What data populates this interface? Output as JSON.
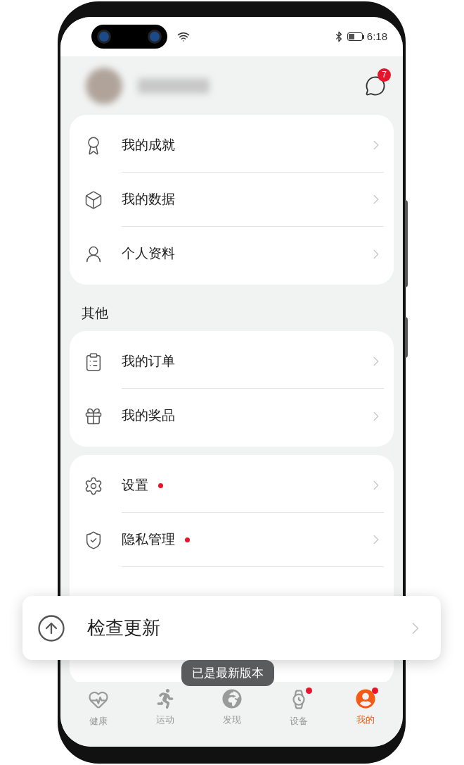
{
  "status_bar": {
    "time": "6:18"
  },
  "header": {
    "messages_badge": "7"
  },
  "sections": [
    {
      "items": [
        {
          "label": "我的成就",
          "dot": false
        },
        {
          "label": "我的数据",
          "dot": false
        },
        {
          "label": "个人资料",
          "dot": false
        }
      ]
    },
    {
      "title": "其他",
      "items": [
        {
          "label": "我的订单",
          "dot": false
        },
        {
          "label": "我的奖品",
          "dot": false
        }
      ]
    },
    {
      "items": [
        {
          "label": "设置",
          "dot": true
        },
        {
          "label": "隐私管理",
          "dot": true
        }
      ]
    }
  ],
  "popup": {
    "label": "检查更新"
  },
  "toast": {
    "text": "已是最新版本"
  },
  "tabs": [
    {
      "label": "健康",
      "selected": false,
      "dot": false
    },
    {
      "label": "运动",
      "selected": false,
      "dot": false
    },
    {
      "label": "发现",
      "selected": false,
      "dot": false
    },
    {
      "label": "设备",
      "selected": false,
      "dot": true
    },
    {
      "label": "我的",
      "selected": true,
      "dot": true
    }
  ]
}
